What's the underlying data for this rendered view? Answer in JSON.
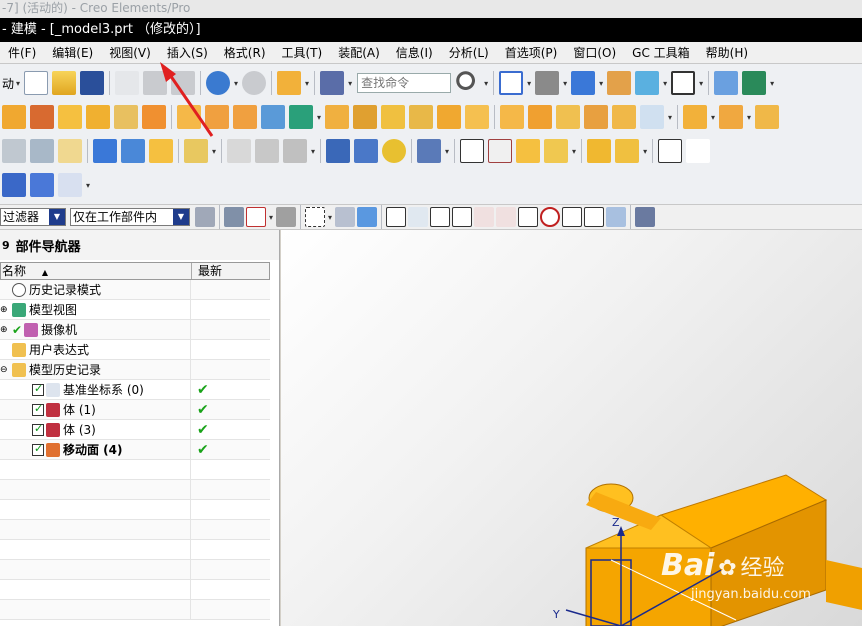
{
  "os_window": {
    "title": "-7] (活动的) - Creo Elements/Pro"
  },
  "window": {
    "title": "- 建模 - [_model3.prt （修改的）]"
  },
  "menu": [
    {
      "label": "件(F)"
    },
    {
      "label": "编辑(E)"
    },
    {
      "label": "视图(V)"
    },
    {
      "label": "插入(S)"
    },
    {
      "label": "格式(R)"
    },
    {
      "label": "工具(T)"
    },
    {
      "label": "装配(A)"
    },
    {
      "label": "信息(I)"
    },
    {
      "label": "分析(L)"
    },
    {
      "label": "首选项(P)"
    },
    {
      "label": "窗口(O)"
    },
    {
      "label": "GC 工具箱"
    },
    {
      "label": "帮助(H)"
    }
  ],
  "toolbar": {
    "start_label": "动",
    "search_placeholder": "查找命令"
  },
  "filterbar": {
    "type_filter": "过滤器",
    "scope_filter": "仅在工作部件内"
  },
  "navigator": {
    "title": "部件导航器",
    "columns": {
      "name": "名称",
      "latest": "最新"
    },
    "rows": [
      {
        "label": "历史记录模式",
        "checked": false,
        "latest": ""
      },
      {
        "label": "模型视图",
        "checked": false,
        "latest": ""
      },
      {
        "label": "摄像机",
        "checked": false,
        "latest": ""
      },
      {
        "label": "用户表达式",
        "checked": false,
        "latest": ""
      },
      {
        "label": "模型历史记录",
        "checked": false,
        "latest": ""
      },
      {
        "label": "基准坐标系 (0)",
        "checked": true,
        "latest": "✔"
      },
      {
        "label": "体 (1)",
        "checked": true,
        "latest": "✔"
      },
      {
        "label": "体 (3)",
        "checked": true,
        "latest": "✔"
      },
      {
        "label": "移动面 (4)",
        "checked": true,
        "latest": "✔"
      }
    ]
  },
  "viewport": {
    "axis_z": "Z",
    "axis_y": "Y"
  },
  "watermark": {
    "brand": "Bai",
    "brand2": "经验",
    "url": "jingyan.baidu.com"
  },
  "colors": {
    "accent_orange": "#f5a500",
    "arrow_red": "#e02020",
    "check_green": "#1aa31a"
  }
}
